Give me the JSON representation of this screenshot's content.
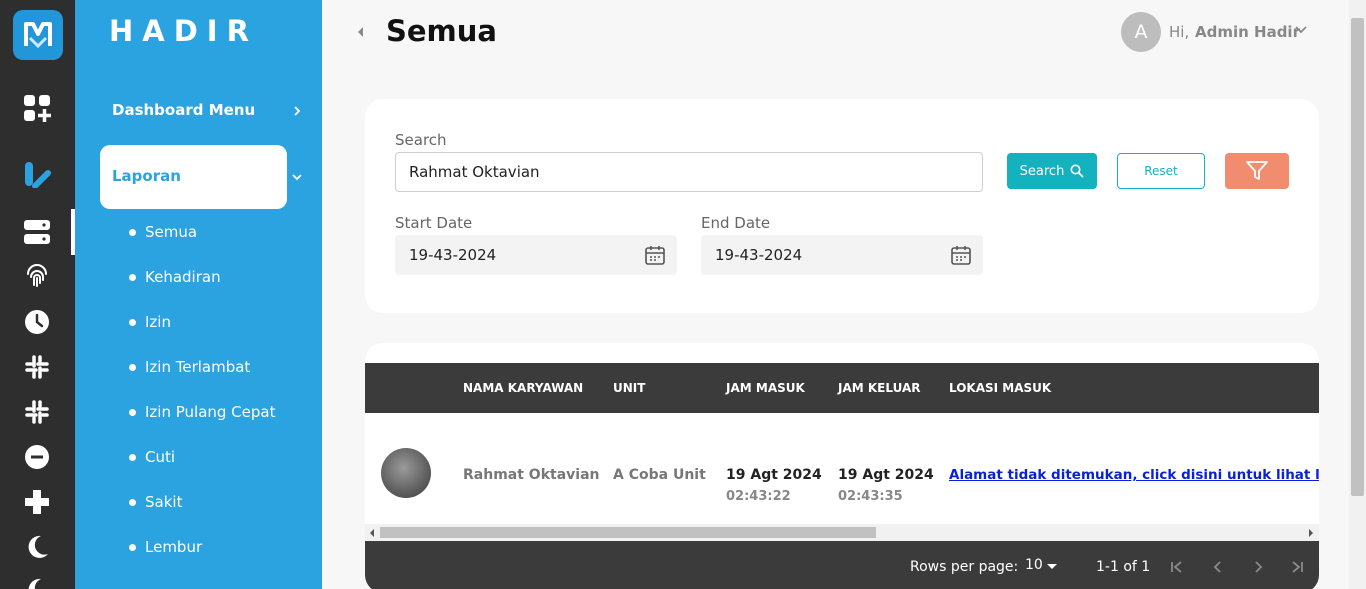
{
  "brand": "HADIR",
  "sidebar": {
    "dashboard_label": "Dashboard Menu",
    "laporan_label": "Laporan",
    "items": [
      {
        "label": "Semua"
      },
      {
        "label": "Kehadiran"
      },
      {
        "label": "Izin"
      },
      {
        "label": "Izin Terlambat"
      },
      {
        "label": "Izin Pulang Cepat"
      },
      {
        "label": "Cuti"
      },
      {
        "label": "Sakit"
      },
      {
        "label": "Lembur"
      }
    ]
  },
  "rail_icons": [
    "app-logo-icon",
    "dashboard-add-icon",
    "report-icon",
    "server-icon",
    "fingerprint-icon",
    "clock-icon",
    "slack-icon",
    "slack-alt-icon",
    "minus-circle-icon",
    "plus-icon",
    "moon-icon",
    "moon-alt-icon"
  ],
  "header": {
    "title": "Semua",
    "avatar_initial": "A",
    "greeting": "Hi,",
    "user_name": "Admin Hadir"
  },
  "filter": {
    "search_label": "Search",
    "search_value": "Rahmat Oktavian",
    "start_label": "Start Date",
    "start_value": "19-43-2024",
    "end_label": "End Date",
    "end_value": "19-43-2024",
    "search_button": "Search",
    "reset_button": "Reset"
  },
  "table": {
    "columns": [
      "NAMA KARYAWAN",
      "UNIT",
      "JAM MASUK",
      "JAM KELUAR",
      "LOKASI MASUK"
    ],
    "rows": [
      {
        "name": "Rahmat Oktavian",
        "unit": "A Coba Unit",
        "in_date": "19 Agt 2024",
        "in_time": "02:43:22",
        "out_date": "19 Agt 2024",
        "out_time": "02:43:35",
        "location": "Alamat tidak ditemukan, click disini untuk lihat lokasi"
      }
    ],
    "rows_per_page_label": "Rows per page:",
    "rows_per_page": "10",
    "range": "1-1 of 1"
  },
  "colors": {
    "rail": "#2e2e2e",
    "sidebar": "#2aa3e0",
    "accent": "#14b2bf",
    "filter_button": "#f28c6e",
    "table_header": "#3b3b3b"
  }
}
